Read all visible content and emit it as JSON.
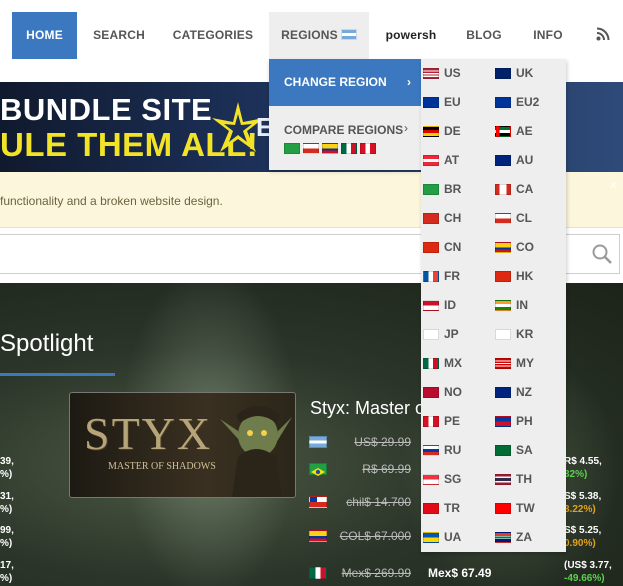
{
  "nav": {
    "home": "HOME",
    "search": "SEARCH",
    "categories": "CATEGORIES",
    "regions": "REGIONS",
    "powersh": "powersh",
    "blog": "BLOG",
    "info": "INFO",
    "rss_icon": "rss-icon"
  },
  "banner": {
    "line1": "BUNDLE SITE",
    "line2": "ULE THEM ALL!",
    "partial": "E",
    "colors": {
      "line1": "#ffffff",
      "line2": "#f2e326"
    }
  },
  "alert": {
    "text": "functionality and a broken website design.",
    "close": "×"
  },
  "search": {
    "placeholder": ""
  },
  "spotlight": {
    "title": "Spotlight",
    "game_art_title": "STYX",
    "game_art_sub": "MASTER OF SHADOWS",
    "game_name": "Styx: Master o",
    "prices": [
      {
        "flag": "ar",
        "old": "US$ 29.99",
        "new": ""
      },
      {
        "flag": "br",
        "old": "R$ 69.99",
        "new": ""
      },
      {
        "flag": "cl",
        "old": "chil$ 14.700",
        "new": ""
      },
      {
        "flag": "co",
        "old": "COL$ 67.000",
        "new": ""
      },
      {
        "flag": "mx",
        "old": "Mex$ 269.99",
        "new": "Mex$ 67.49"
      }
    ],
    "left_side": [
      "39,",
      "%)",
      "31,",
      "%)",
      "99,",
      "%)",
      "17,",
      "%)"
    ],
    "right_side": [
      {
        "a": "R$ 4.55,",
        "b": "32%)"
      },
      {
        "a": "S$ 5.38,",
        "b": "3.22%)"
      },
      {
        "a": "S$ 5.25,",
        "b": "0.90%)"
      },
      {
        "a": "(US$ 3.77,",
        "b": "-49.66%)"
      }
    ]
  },
  "dropdown": {
    "change_region": "CHANGE REGION",
    "compare_regions": "COMPARE REGIONS",
    "chevron": "›",
    "compare_flags": [
      "br",
      "cl",
      "co",
      "mx",
      "pe"
    ]
  },
  "regions": [
    [
      "US",
      "UK"
    ],
    [
      "EU",
      "EU2"
    ],
    [
      "DE",
      "AE"
    ],
    [
      "AT",
      "AU"
    ],
    [
      "BR",
      "CA"
    ],
    [
      "CH",
      "CL"
    ],
    [
      "CN",
      "CO"
    ],
    [
      "FR",
      "HK"
    ],
    [
      "ID",
      "IN"
    ],
    [
      "JP",
      "KR"
    ],
    [
      "MX",
      "MY"
    ],
    [
      "NO",
      "NZ"
    ],
    [
      "PE",
      "PH"
    ],
    [
      "RU",
      "SA"
    ],
    [
      "SG",
      "TH"
    ],
    [
      "TR",
      "TW"
    ],
    [
      "UA",
      "ZA"
    ]
  ]
}
